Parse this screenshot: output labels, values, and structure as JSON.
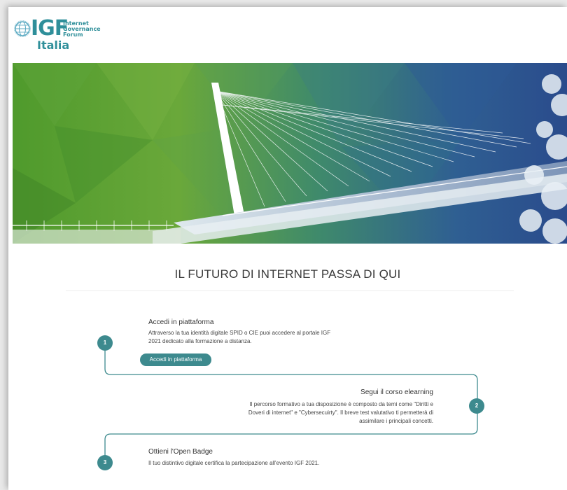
{
  "brand": {
    "logo_main": "IGF",
    "logo_sub_lines": [
      "Internet",
      "Governance",
      "Forum"
    ],
    "logo_country": "Italia",
    "accent_color": "#3d8a8e"
  },
  "hero": {
    "icon": "bridge-image"
  },
  "main": {
    "title": "IL FUTURO DI INTERNET PASSA DI QUI"
  },
  "steps": [
    {
      "number": "1",
      "title": "Accedi in piattaforma",
      "desc_lines": [
        "Attraverso la tua identità digitale SPID o CIE puoi accedere al portale IGF",
        "2021 dedicato alla formazione a distanza."
      ],
      "button_label": "Accedi in piattaforma"
    },
    {
      "number": "2",
      "title": "Segui il corso elearning",
      "desc_lines": [
        "Il percorso formativo a tua disposizione è composto da temi come \"Diritti e",
        "Doveri di internet\" e \"Cybersecuirty\". Il breve test valutativo ti permetterà di",
        "assimilare i principali concetti."
      ]
    },
    {
      "number": "3",
      "title": "Ottieni l'Open Badge",
      "desc_lines": [
        "Il tuo distintivo digitale certifica la partecipazione all'evento IGF 2021."
      ]
    }
  ]
}
